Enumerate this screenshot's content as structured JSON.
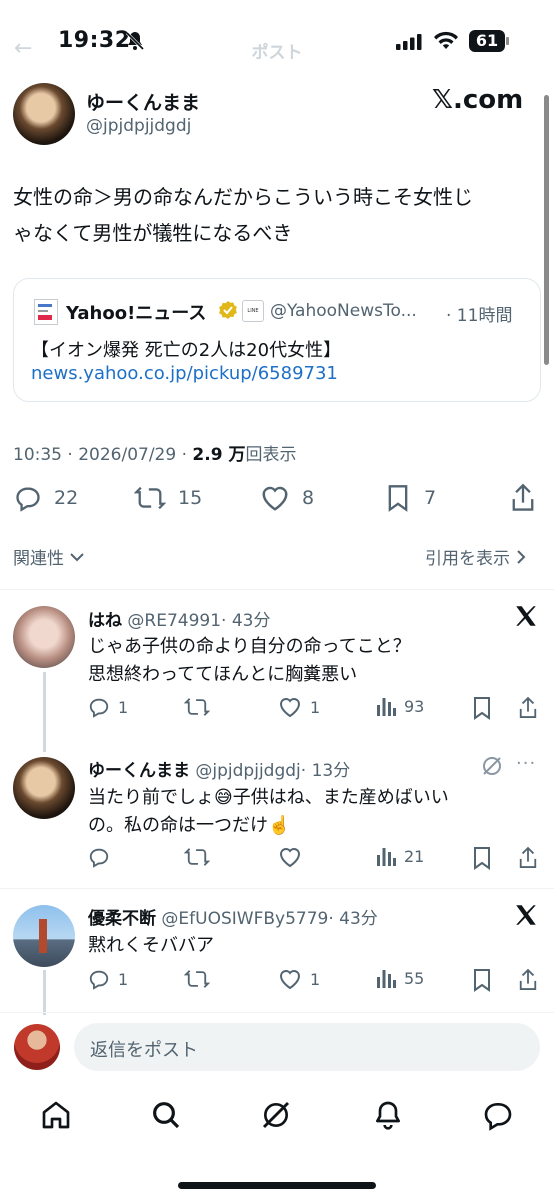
{
  "status_bar": {
    "time": "19:32",
    "battery": "61"
  },
  "header": {
    "title": "ポスト"
  },
  "post": {
    "display_name": "ゆーくんまま",
    "handle": "@jpjdpjjdgdj",
    "brand": "𝕏.com",
    "text_line1": "女性の命＞男の命なんだからこういう時こそ女性じ",
    "text_line2": "ゃなくて男性が犠牲になるべき",
    "quote": {
      "name": "Yahoo!ニュース",
      "handle": "@YahooNewsTo...",
      "time": "· 11時間",
      "line": "【イオン爆発 死亡の2人は20代女性】",
      "link": "news.yahoo.co.jp/pickup/6589731"
    },
    "meta_time": "10:35 · 2026/07/29 · ",
    "meta_views": "2.9 万",
    "meta_views_label": "回表示",
    "actions": {
      "replies": "22",
      "reposts": "15",
      "likes": "8",
      "bookmarks": "7"
    }
  },
  "sort": {
    "label": "関連性",
    "quotes_link": "引用を表示"
  },
  "replies": [
    {
      "name": "はね",
      "handle": "@RE74991",
      "time": "· 43分",
      "line1": "じゃあ子供の命より自分の命ってこと？",
      "line2": "思想終わっててほんとに胸糞悪い",
      "replies": "1",
      "reposts": "",
      "likes": "1",
      "views": "93"
    },
    {
      "name": "ゆーくんまま",
      "handle": "@jpjdpjjdgdj",
      "time": "· 13分",
      "line1": "当たり前でしょ😅子供はね、また産めばいい",
      "line2": "の。私の命は一つだけ☝️",
      "replies": "",
      "reposts": "",
      "likes": "",
      "views": "21"
    },
    {
      "name": "優柔不断",
      "handle": "@EfUOSIWFBy5779",
      "time": "· 43分",
      "line1": "黙れくそババア",
      "line2": "",
      "replies": "1",
      "reposts": "",
      "likes": "1",
      "views": "55"
    }
  ],
  "composer": {
    "placeholder": "返信をポスト"
  },
  "colors": {
    "link": "#1d70c8",
    "muted": "#536471",
    "text": "#0f1419",
    "verified": "#e2b719"
  }
}
